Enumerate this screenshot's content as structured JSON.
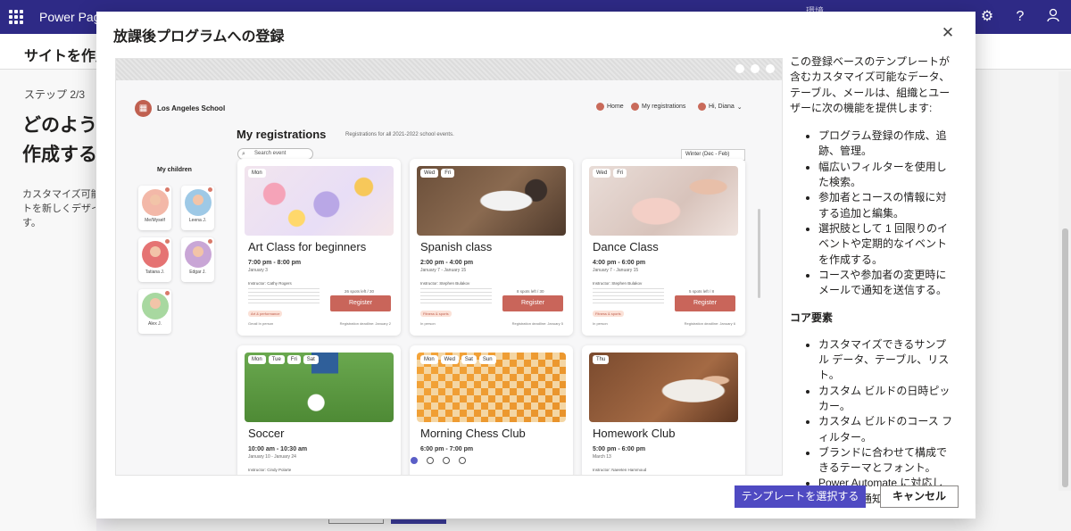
{
  "app": {
    "title": "Power Pages",
    "env_label": "環境",
    "icons": [
      "waffle-icon",
      "settings-icon",
      "help-icon",
      "account-icon"
    ]
  },
  "background": {
    "page_title": "サイトを作成",
    "step": "ステップ 2/3",
    "heading_line1": "どのようなサイトを",
    "heading_line2": "作成するかを",
    "desc_line1": "カスタマイズ可能なテンプレートを選択します。",
    "desc_line2": "トを新しくデザインできます。",
    "desc_line3": "す。"
  },
  "modal": {
    "title": "放課後プログラムへの登録",
    "close_icon": "close-icon",
    "intro": "この登録ベースのテンプレートが含むカスタマイズ可能なデータ、テーブル、メールは、組織とユーザーに次の機能を提供します:",
    "features": [
      "プログラム登録の作成、追跡、管理。",
      "幅広いフィルターを使用した検索。",
      "参加者とコースの情報に対する追加と編集。",
      "選択肢として 1 回限りのイベントや定期的なイベントを作成する。",
      "コースや参加者の変更時にメールで通知を送信する。"
    ],
    "core_title": "コア要素",
    "core_items": [
      "カスタマイズできるサンプル データ、テーブル、リスト。",
      "カスタム ビルドの日時ピッカー。",
      "カスタム ビルドのコース フィルター。",
      "ブランドに合わせて構成できるテーマとフォント。",
      "Power Automate に対応したメール通知。"
    ],
    "select_button": "テンプレートを選択する",
    "cancel_button": "キャンセル"
  },
  "preview": {
    "school_name": "Los Angeles School",
    "nav": {
      "home": "Home",
      "my_registrations": "My registrations",
      "user": "Hi, Diana"
    },
    "page_title": "My registrations",
    "page_subtitle": "Registrations for all 2021-2022 school events.",
    "search_placeholder": "Search event",
    "season_filter": "Winter (Dec - Feb)",
    "children_label": "My children",
    "children": [
      "Me/Myself",
      "Leena J.",
      "Tatiana J.",
      "Edgar J.",
      "Alex J."
    ],
    "register_label": "Register",
    "cards": [
      {
        "days": [
          "Mon"
        ],
        "name": "Art Class for beginners",
        "time": "7:00 pm - 8:00 pm",
        "dates": "January 3",
        "instructor": "Instructor: Cathy Rogers",
        "spots": "26 spots left / 30",
        "tag": "Art & performance",
        "foot_left": "Gmail   In person",
        "foot_right": "Registration deadline: January 2"
      },
      {
        "days": [
          "Wed",
          "Fri"
        ],
        "name": "Spanish class",
        "time": "2:00 pm - 4:00 pm",
        "dates": "January 7 - January 15",
        "instructor": "Instructor: Stephen Bulakov",
        "spots": "8 spots left / 30",
        "tag": "Fitness & sports",
        "foot_left": "In person",
        "foot_right": "Registration deadline: January 5"
      },
      {
        "days": [
          "Wed",
          "Fri"
        ],
        "name": "Dance Class",
        "time": "4:00 pm - 6:00 pm",
        "dates": "January 7 - January 15",
        "instructor": "Instructor: Stephen Bulakov",
        "spots": "5 spots left / 8",
        "tag": "Fitness & sports",
        "foot_left": "In person",
        "foot_right": "Registration deadline: January 6"
      },
      {
        "days": [
          "Mon",
          "Tue",
          "Fri",
          "Sat"
        ],
        "name": "Soccer",
        "time": "10:00 am - 10:30 am",
        "dates": "January 10 - January 24",
        "instructor": "Instructor: Cindy Polarte"
      },
      {
        "days": [
          "Mon",
          "Wed",
          "Sat",
          "Sun"
        ],
        "name": "Morning Chess Club",
        "time": "6:00 pm - 7:00 pm",
        "dates": "",
        "instructor": ""
      },
      {
        "days": [
          "Thu"
        ],
        "name": "Homework Club",
        "time": "5:00 pm - 6:00 pm",
        "dates": "March 13",
        "instructor": "Instructor: Naeeten Hammoud"
      }
    ]
  }
}
